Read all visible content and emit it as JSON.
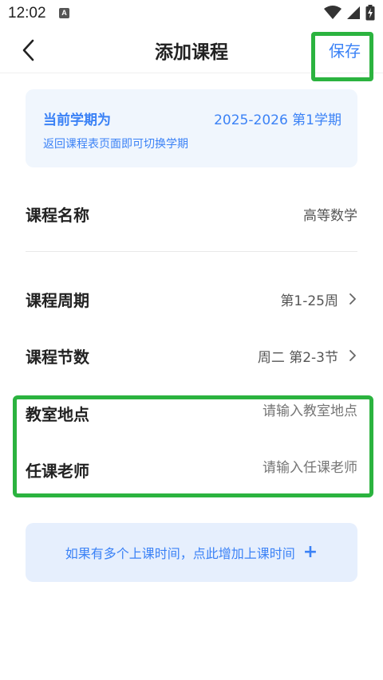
{
  "status_bar": {
    "time": "12:02",
    "app_icon_letter": "A"
  },
  "header": {
    "title": "添加课程",
    "save_label": "保存"
  },
  "semester": {
    "label": "当前学期为",
    "value": "2025-2026  第1学期",
    "hint": "返回课程表页面即可切换学期"
  },
  "form": {
    "course_name": {
      "label": "课程名称",
      "value": "高等数学"
    },
    "course_weeks": {
      "label": "课程周期",
      "value": "第1-25周"
    },
    "course_sessions": {
      "label": "课程节数",
      "value": "周二 第2-3节"
    },
    "classroom": {
      "label": "教室地点",
      "placeholder": "请输入教室地点"
    },
    "teacher": {
      "label": "任课老师",
      "placeholder": "请输入任课老师"
    }
  },
  "add_time": {
    "label": "如果有多个上课时间，点此增加上课时间",
    "plus": "+"
  },
  "colors": {
    "accent": "#3b82f6",
    "highlight": "#2bb33f",
    "card_bg": "#f0f6fd"
  }
}
